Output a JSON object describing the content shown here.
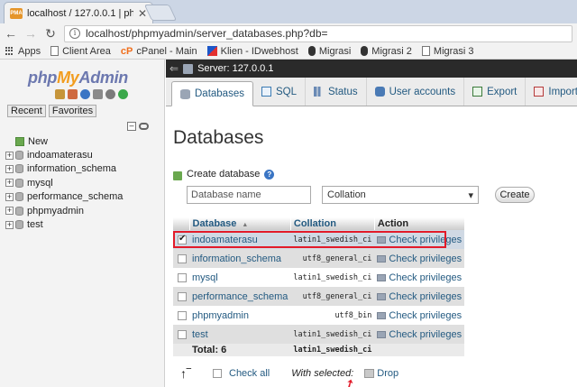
{
  "browser": {
    "tab_title": "localhost / 127.0.0.1 | php",
    "url": "localhost/phpmyadmin/server_databases.php?db=",
    "bookmarks": [
      "Apps",
      "Client Area",
      "cPanel - Main",
      "Klien - IDwebhost",
      "Migrasi",
      "Migrasi 2",
      "Migrasi 3"
    ]
  },
  "sidebar": {
    "logo": {
      "php": "php",
      "my": "My",
      "admin": "Admin"
    },
    "tabs": [
      "Recent",
      "Favorites"
    ],
    "tree": [
      "New",
      "indoamaterasu",
      "information_schema",
      "mysql",
      "performance_schema",
      "phpmyadmin",
      "test"
    ]
  },
  "main": {
    "server_label": "Server: 127.0.0.1",
    "tabs": [
      "Databases",
      "SQL",
      "Status",
      "User accounts",
      "Export",
      "Import"
    ],
    "page_title": "Databases",
    "create": {
      "label": "Create database",
      "name_placeholder": "Database name",
      "collation_value": "Collation",
      "button": "Create"
    },
    "table": {
      "headers": [
        "Database",
        "Collation",
        "Action"
      ],
      "rows": [
        {
          "name": "indoamaterasu",
          "collation": "latin1_swedish_ci",
          "action": "Check privileges",
          "checked": true
        },
        {
          "name": "information_schema",
          "collation": "utf8_general_ci",
          "action": "Check privileges",
          "checked": false
        },
        {
          "name": "mysql",
          "collation": "latin1_swedish_ci",
          "action": "Check privileges",
          "checked": false
        },
        {
          "name": "performance_schema",
          "collation": "utf8_general_ci",
          "action": "Check privileges",
          "checked": false
        },
        {
          "name": "phpmyadmin",
          "collation": "utf8_bin",
          "action": "Check privileges",
          "checked": false
        },
        {
          "name": "test",
          "collation": "latin1_swedish_ci",
          "action": "Check privileges",
          "checked": false
        }
      ],
      "total_label": "Total: 6",
      "total_collation": "latin1_swedish_ci"
    },
    "bottom": {
      "check_all": "Check all",
      "with_selected": "With selected:",
      "drop": "Drop"
    }
  },
  "colors": {
    "highlight_border": "#e21b2a",
    "link": "#235a81"
  }
}
